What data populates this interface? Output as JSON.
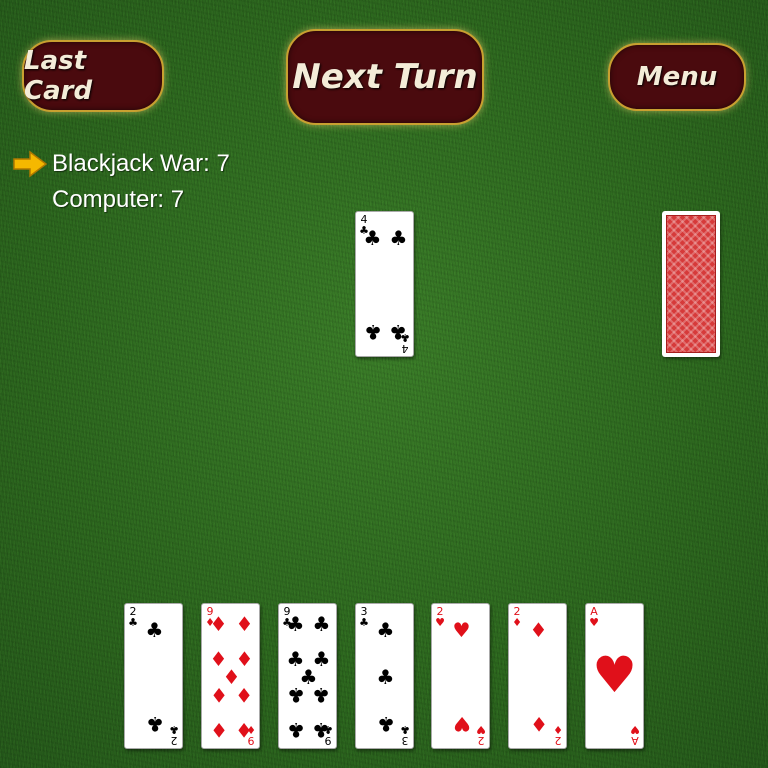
{
  "buttons": {
    "last_card": "Last Card",
    "next_turn": "Next Turn",
    "menu": "Menu"
  },
  "scores": [
    {
      "name": "Blackjack War",
      "score": 7,
      "text": "Blackjack War: 7",
      "active": true
    },
    {
      "name": "Computer",
      "score": 7,
      "text": "Computer: 7",
      "active": false
    }
  ],
  "play_card": {
    "rank": "4",
    "suit": "clubs",
    "suit_symbol": "♣",
    "color": "black"
  },
  "deck": {
    "face": "down",
    "back_color": "#d63a3a"
  },
  "hand": [
    {
      "rank": "2",
      "suit": "clubs",
      "suit_symbol": "♣",
      "color": "black"
    },
    {
      "rank": "9",
      "suit": "diamonds",
      "suit_symbol": "♦",
      "color": "red"
    },
    {
      "rank": "9",
      "suit": "clubs",
      "suit_symbol": "♣",
      "color": "black"
    },
    {
      "rank": "3",
      "suit": "clubs",
      "suit_symbol": "♣",
      "color": "black"
    },
    {
      "rank": "2",
      "suit": "hearts",
      "suit_symbol": "♥",
      "color": "red"
    },
    {
      "rank": "2",
      "suit": "diamonds",
      "suit_symbol": "♦",
      "color": "red"
    },
    {
      "rank": "A",
      "suit": "hearts",
      "suit_symbol": "♥",
      "color": "red"
    }
  ],
  "colors": {
    "button_bg": "#4a0a0e",
    "button_border": "#c8a030",
    "table_green": "#2d6a1f",
    "arrow": "#f5b800"
  }
}
